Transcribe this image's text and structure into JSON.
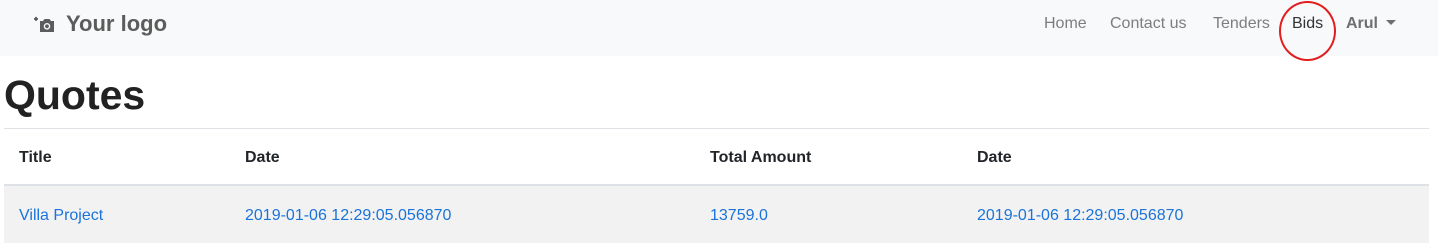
{
  "navbar": {
    "brand_label": "Your logo",
    "brand_icon": "camera-plus-icon",
    "items": [
      {
        "label": "Home"
      },
      {
        "label": "Contact us"
      },
      {
        "label": "Tenders"
      },
      {
        "label": "Bids",
        "active": true
      }
    ],
    "user": {
      "label": "Arul"
    },
    "highlight_color": "#e21d1d"
  },
  "page": {
    "title": "Quotes"
  },
  "table": {
    "headers": [
      "Title",
      "Date",
      "Total Amount",
      "Date"
    ],
    "rows": [
      [
        "Villa Project",
        "2019-01-06 12:29:05.056870",
        "13759.0",
        "2019-01-06 12:29:05.056870"
      ]
    ],
    "link_color": "#1a73d9",
    "stripe_color": "#f2f2f2"
  }
}
